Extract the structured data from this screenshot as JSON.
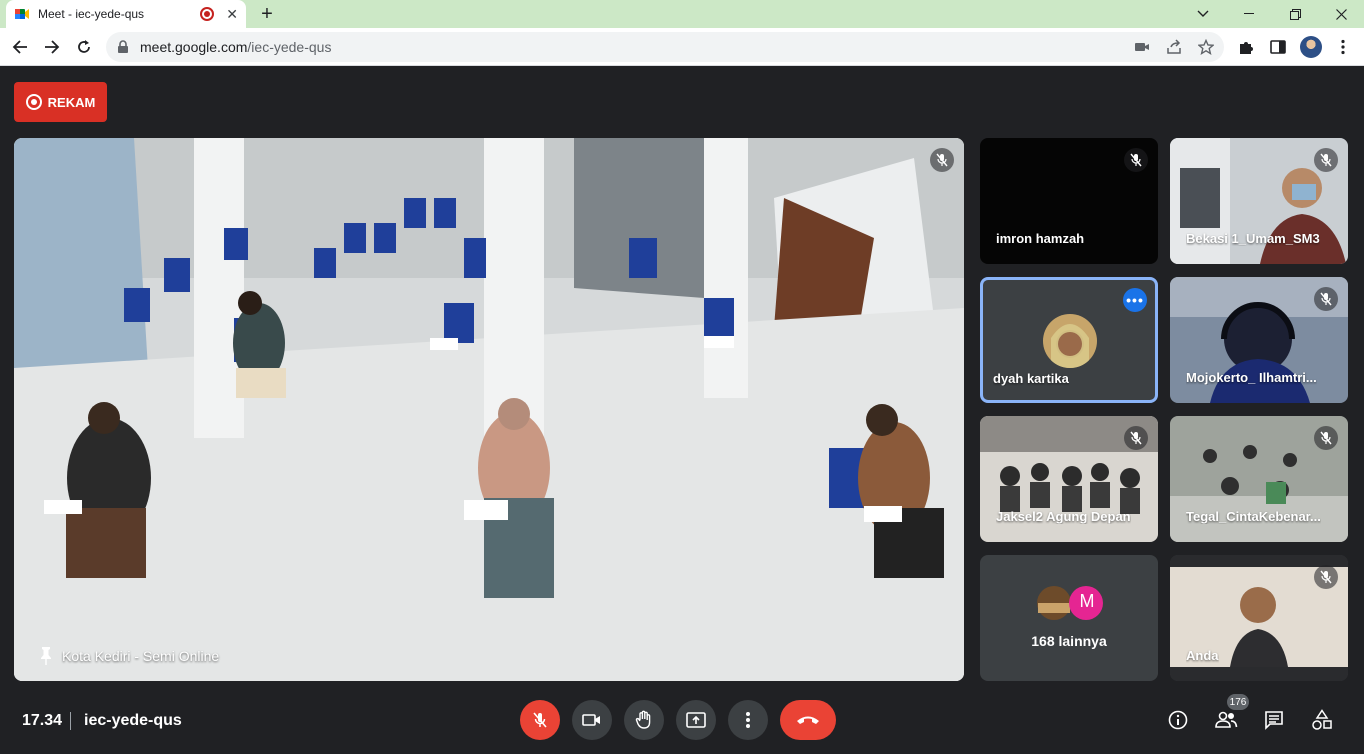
{
  "browser": {
    "tab_title": "Meet - iec-yede-qus",
    "url_host": "meet.google.com",
    "url_path": "/iec-yede-qus"
  },
  "meet": {
    "record_label": "REKAM",
    "main_tile": {
      "name": "Kota Kediri - Semi Online"
    },
    "participants": [
      {
        "name": "imron hamzah"
      },
      {
        "name": "Bekasi 1_Umam_SM3"
      },
      {
        "name": "dyah kartika"
      },
      {
        "name": "Mojokerto_ Ilhamtri..."
      },
      {
        "name": "Jaksel2 Agung Depan"
      },
      {
        "name": "Tegal_CintaKebenar..."
      },
      {
        "name": "168 lainnya",
        "avatar_letter": "M"
      },
      {
        "name": "Anda"
      }
    ],
    "time": "17.34",
    "meeting_code": "iec-yede-qus",
    "participant_count": "176"
  },
  "colors": {
    "end_call": "#ea4335",
    "active_border": "#8ab4f8",
    "record": "#d93025"
  }
}
